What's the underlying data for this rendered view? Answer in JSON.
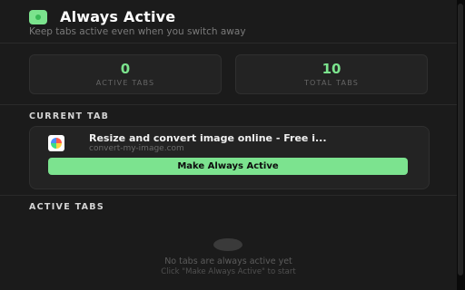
{
  "header": {
    "title": "Always Active",
    "subtitle": "Keep tabs active even when you switch away"
  },
  "stats": [
    {
      "value": "0",
      "label": "ACTIVE TABS"
    },
    {
      "value": "10",
      "label": "TOTAL TABS"
    }
  ],
  "current_tab": {
    "section_label": "CURRENT TAB",
    "title": "Resize and convert image online - Free i...",
    "url": "convert-my-image.com",
    "button_label": "Make Always Active"
  },
  "active_tabs": {
    "section_label": "ACTIVE TABS",
    "empty_title": "No tabs are always active yet",
    "empty_hint": "Click \"Make Always Active\" to start"
  },
  "colors": {
    "accent": "#7be38d",
    "background": "#1b1b1b",
    "card": "#232323"
  },
  "icons": {
    "logo": "app-logo-icon",
    "favicon": "site-favicon-icon"
  }
}
